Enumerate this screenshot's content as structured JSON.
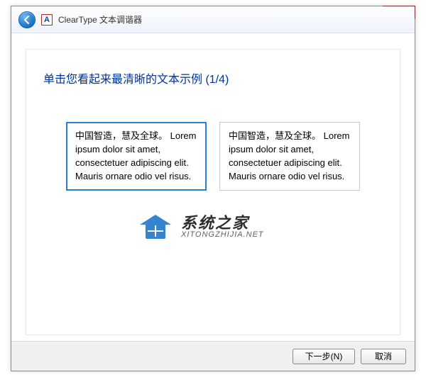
{
  "window": {
    "app_title": "ClearType 文本调谐器",
    "app_icon_letter": "A"
  },
  "heading": "单击您看起来最清晰的文本示例 (1/4)",
  "samples": [
    {
      "chinese": "中国智造，慧及全球。",
      "latin": "Lorem ipsum dolor sit amet, consectetuer adipiscing elit. Mauris ornare odio vel risus.",
      "selected": true
    },
    {
      "chinese": "中国智造，慧及全球。",
      "latin": "Lorem ipsum dolor sit amet, consectetuer adipiscing elit. Mauris ornare odio vel risus.",
      "selected": false
    }
  ],
  "footer": {
    "next_label": "下一步(N)",
    "cancel_label": "取消"
  },
  "watermark": {
    "cn": "系统之家",
    "en": "XITONGZHIJIA.NET"
  }
}
